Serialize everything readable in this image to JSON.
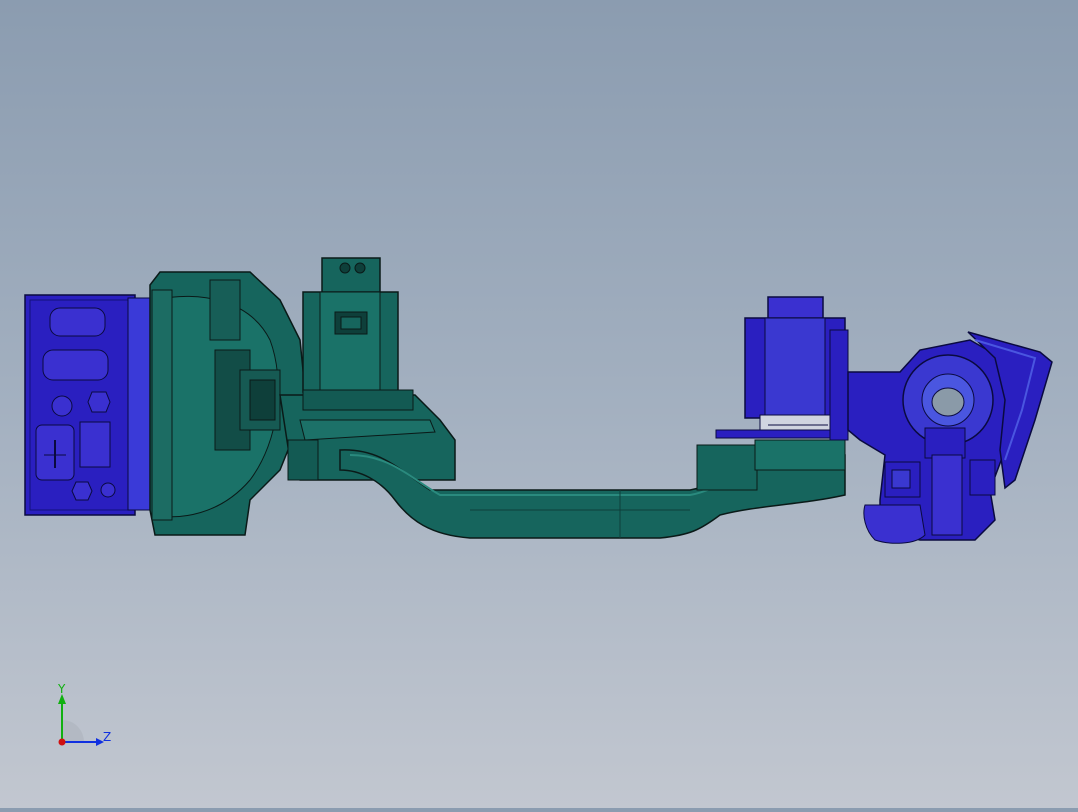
{
  "viewport": {
    "background_top": "#8b9cb0",
    "background_bottom": "#c2c7d0"
  },
  "model": {
    "colors": {
      "teal": "#16655d",
      "teal_dark": "#0d3f3a",
      "teal_light": "#2a8a7e",
      "blue": "#2a1fc0",
      "blue_dark": "#13107a",
      "blue_light": "#4a56e0",
      "edge": "#0a1a18"
    },
    "parts": [
      "base-motor-housing",
      "shoulder-casting",
      "upper-motor",
      "forearm-tube",
      "elbow-motor",
      "wrist-assembly",
      "wrist-cover"
    ]
  },
  "triad": {
    "y_label": "Y",
    "z_label": "Z",
    "colors": {
      "y": "#10b010",
      "z": "#1030e0",
      "x": "#d01010"
    }
  }
}
